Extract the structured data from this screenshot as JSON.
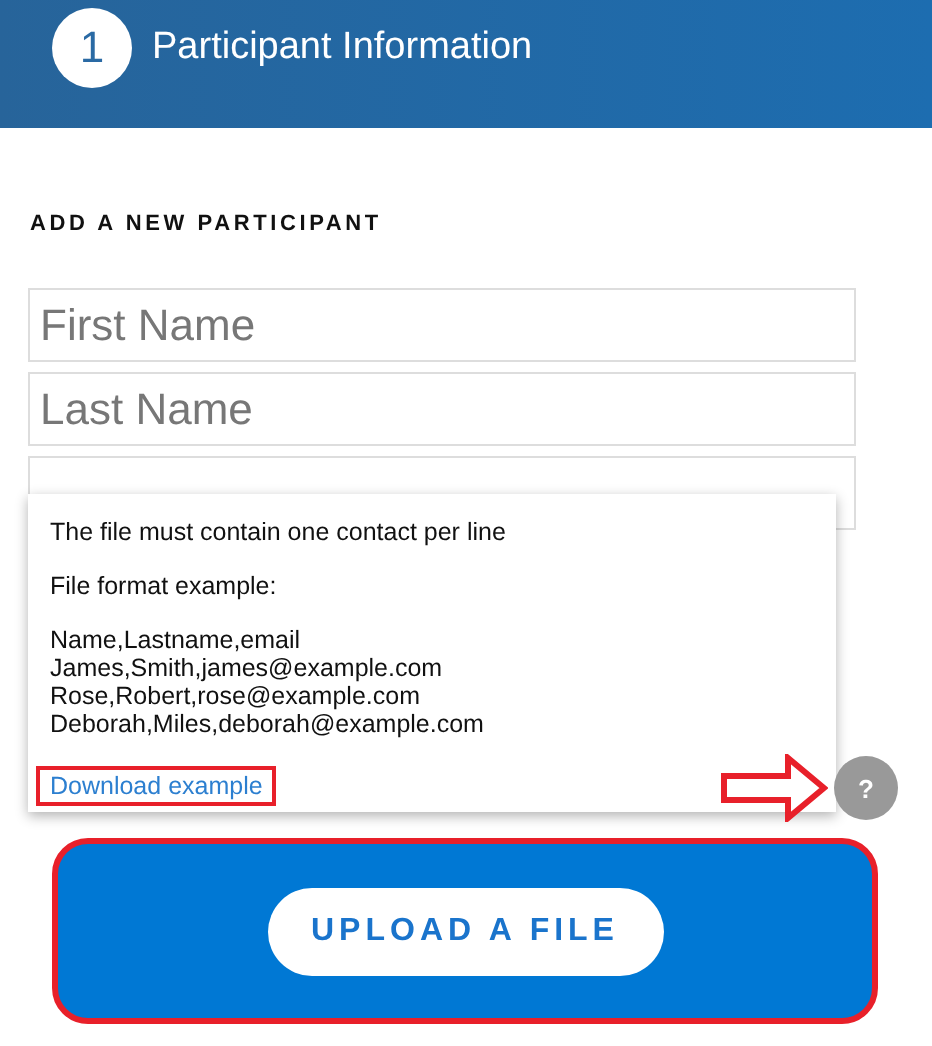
{
  "header": {
    "step": "1",
    "title": "Participant Information"
  },
  "section_title": "ADD A NEW PARTICIPANT",
  "fields": [
    {
      "kind": "text",
      "placeholder": "First Name"
    },
    {
      "kind": "text",
      "placeholder": "Last Name"
    },
    {
      "kind": "text"
    }
  ],
  "tooltip": {
    "intro": "The file must contain one contact per line",
    "format_label": "File format example:",
    "example_lines": [
      "Name,Lastname,email",
      "James,Smith,james@example.com",
      "Rose,Robert,rose@example.com",
      "Deborah,Miles,deborah@example.com"
    ],
    "link": "Download example",
    "link_highlighted": true
  },
  "help_button": {
    "label": "?",
    "highlighted": true
  },
  "upload": {
    "label": "UPLOAD A FILE",
    "highlighted": true
  }
}
